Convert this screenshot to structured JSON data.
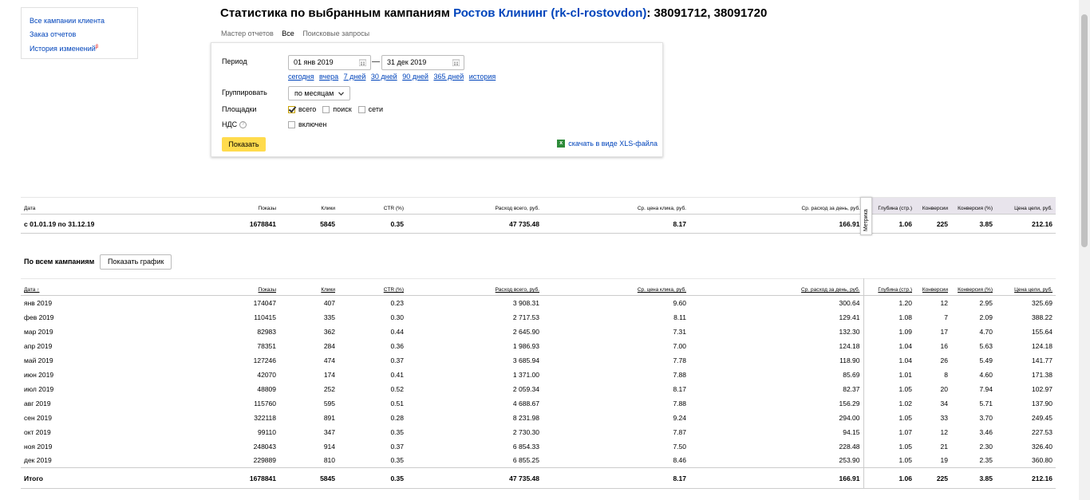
{
  "sidebar": {
    "items": [
      {
        "label": "Все кампании клиента"
      },
      {
        "label": "Заказ отчетов"
      },
      {
        "label": "История изменений",
        "badge": "β"
      }
    ]
  },
  "header": {
    "title_prefix": "Статистика по выбранным кампаниям",
    "client": "Ростов Клининг (rk-cl-rostovdon)",
    "campaigns": ": 38091712, 38091720"
  },
  "tabs": [
    {
      "label": "Мастер отчетов",
      "active": false
    },
    {
      "label": "Все",
      "active": true
    },
    {
      "label": "Поисковые запросы",
      "active": false
    }
  ],
  "filters": {
    "period_label": "Период",
    "date_from": "01 янв 2019",
    "date_to": "31 дек 2019",
    "dash": "—",
    "quick_ranges": [
      "сегодня",
      "вчера",
      "7 дней",
      "30 дней",
      "90 дней",
      "365 дней",
      "история"
    ],
    "group_label": "Группировать",
    "group_value": "по месяцам",
    "platforms_label": "Площадки",
    "platforms": [
      {
        "label": "всего",
        "checked": true
      },
      {
        "label": "поиск",
        "checked": false
      },
      {
        "label": "сети",
        "checked": false
      }
    ],
    "vat_label": "НДС",
    "vat_option": "включен",
    "vat_checked": false,
    "show_button": "Показать",
    "xls_link": "скачать в виде XLS-файла"
  },
  "summary": {
    "headers": [
      "Дата",
      "Показы",
      "Клики",
      "CTR (%)",
      "Расход всего, руб.",
      "Ср. цена клика, руб.",
      "Ср. расход за день, руб.",
      "Глубина (стр.)",
      "Конверсии",
      "Конверсия (%)",
      "Цена цели, руб."
    ],
    "row": [
      "с 01.01.19 по 31.12.19",
      "1678841",
      "5845",
      "0.35",
      "47 735.48",
      "8.17",
      "166.91",
      "1.06",
      "225",
      "3.85",
      "212.16"
    ],
    "metrika_tab": "Метрика"
  },
  "all_campaigns": {
    "label": "По всем кампаниям",
    "graph_button": "Показать график"
  },
  "detail": {
    "headers": [
      "Дата ↑",
      "Показы",
      "Клики",
      "CTR (%)",
      "Расход всего, руб.",
      "Ср. цена клика, руб.",
      "Ср. расход за день, руб.",
      "Глубина (стр.)",
      "Конверсии",
      "Конверсия (%)",
      "Цена цели, руб."
    ],
    "rows": [
      [
        "янв 2019",
        "174047",
        "407",
        "0.23",
        "3 908.31",
        "9.60",
        "300.64",
        "1.20",
        "12",
        "2.95",
        "325.69"
      ],
      [
        "фев 2019",
        "110415",
        "335",
        "0.30",
        "2 717.53",
        "8.11",
        "129.41",
        "1.08",
        "7",
        "2.09",
        "388.22"
      ],
      [
        "мар 2019",
        "82983",
        "362",
        "0.44",
        "2 645.90",
        "7.31",
        "132.30",
        "1.09",
        "17",
        "4.70",
        "155.64"
      ],
      [
        "апр 2019",
        "78351",
        "284",
        "0.36",
        "1 986.93",
        "7.00",
        "124.18",
        "1.04",
        "16",
        "5.63",
        "124.18"
      ],
      [
        "май 2019",
        "127246",
        "474",
        "0.37",
        "3 685.94",
        "7.78",
        "118.90",
        "1.04",
        "26",
        "5.49",
        "141.77"
      ],
      [
        "июн 2019",
        "42070",
        "174",
        "0.41",
        "1 371.00",
        "7.88",
        "85.69",
        "1.01",
        "8",
        "4.60",
        "171.38"
      ],
      [
        "июл 2019",
        "48809",
        "252",
        "0.52",
        "2 059.34",
        "8.17",
        "82.37",
        "1.05",
        "20",
        "7.94",
        "102.97"
      ],
      [
        "авг 2019",
        "115760",
        "595",
        "0.51",
        "4 688.67",
        "7.88",
        "156.29",
        "1.02",
        "34",
        "5.71",
        "137.90"
      ],
      [
        "сен 2019",
        "322118",
        "891",
        "0.28",
        "8 231.98",
        "9.24",
        "294.00",
        "1.05",
        "33",
        "3.70",
        "249.45"
      ],
      [
        "окт 2019",
        "99110",
        "347",
        "0.35",
        "2 730.30",
        "7.87",
        "94.15",
        "1.07",
        "12",
        "3.46",
        "227.53"
      ],
      [
        "ноя 2019",
        "248043",
        "914",
        "0.37",
        "6 854.33",
        "7.50",
        "228.48",
        "1.05",
        "21",
        "2.30",
        "326.40"
      ],
      [
        "дек 2019",
        "229889",
        "810",
        "0.35",
        "6 855.25",
        "8.46",
        "253.90",
        "1.05",
        "19",
        "2.35",
        "360.80"
      ]
    ],
    "total": [
      "Итого",
      "1678841",
      "5845",
      "0.35",
      "47 735.48",
      "8.17",
      "166.91",
      "1.06",
      "225",
      "3.85",
      "212.16"
    ]
  }
}
